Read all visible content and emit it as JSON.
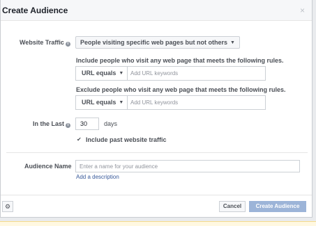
{
  "dialog": {
    "title": "Create Audience",
    "close_symbol": "×"
  },
  "website_traffic": {
    "label": "Website Traffic",
    "selected": "People visiting specific web pages but not others"
  },
  "include_rule": {
    "description": "Include people who visit any web page that meets the following rules.",
    "operator": "URL equals",
    "keywords_placeholder": "Add URL keywords"
  },
  "exclude_rule": {
    "description": "Exclude people who visit any web page that meets the following rules.",
    "operator": "URL equals",
    "keywords_placeholder": "Add URL keywords"
  },
  "in_the_last": {
    "label": "In the Last",
    "value": "30",
    "unit": "days"
  },
  "include_past": {
    "label": "Include past website traffic",
    "checked": true
  },
  "audience_name": {
    "label": "Audience Name",
    "placeholder": "Enter a name for your audience",
    "add_description": "Add a description"
  },
  "footer": {
    "cancel_label": "Cancel",
    "create_label": "Create Audience"
  },
  "icons": {
    "info": "info-icon",
    "caret": "caret-down-icon",
    "check": "checkmark-icon",
    "gear": "gear-icon",
    "close": "close-icon"
  },
  "colors": {
    "primary_disabled": "#9cb4d8",
    "link": "#365899"
  }
}
